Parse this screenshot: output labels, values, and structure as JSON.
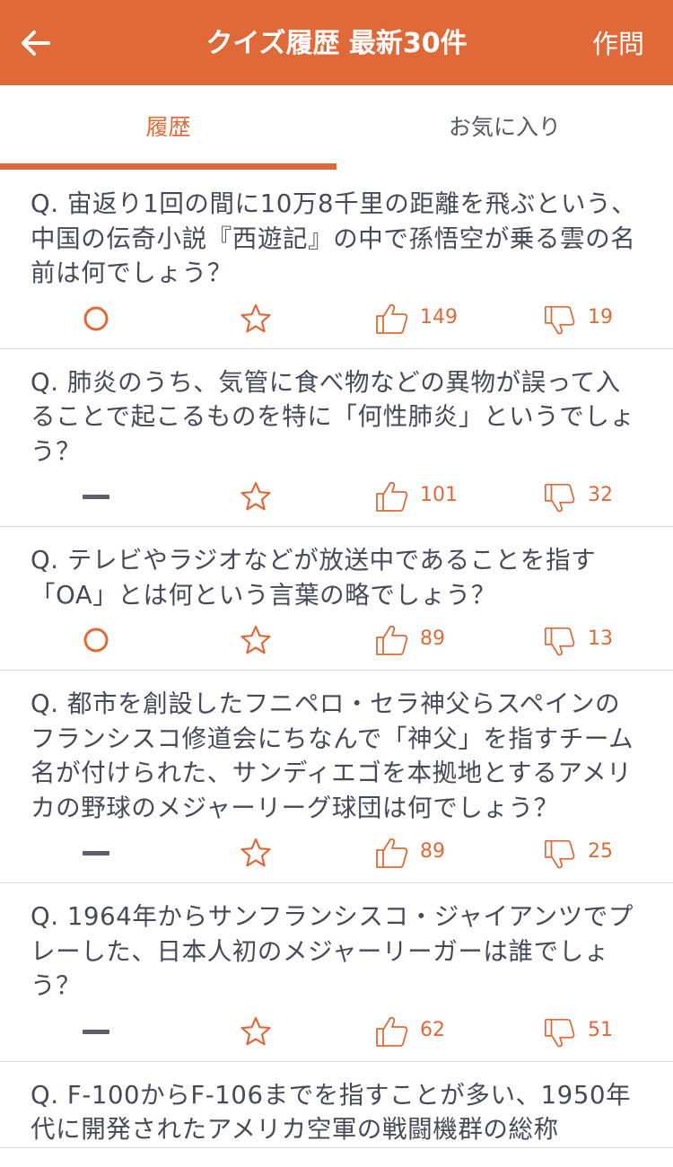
{
  "header": {
    "title": "クイズ履歴 最新30件",
    "compose_label": "作問"
  },
  "tabs": [
    {
      "label": "履歴",
      "active": true
    },
    {
      "label": "お気に入り",
      "active": false
    }
  ],
  "colors": {
    "accent": "#e0693a",
    "divider": "#d9d9d9",
    "text": "#444a58"
  },
  "items": [
    {
      "question": "Q. 宙返り1回の間に10万8千里の距離を飛ぶという、中国の伝奇小説『西遊記』の中で孫悟空が乗る雲の名前は何でしょう？",
      "result": "correct",
      "likes": "149",
      "dislikes": "19"
    },
    {
      "question": "Q. 肺炎のうち、気管に食べ物などの異物が誤って入ることで起こるものを特に「何性肺炎」というでしょう？",
      "result": "none",
      "likes": "101",
      "dislikes": "32"
    },
    {
      "question": "Q. テレビやラジオなどが放送中であることを指す「OA」とは何という言葉の略でしょう？",
      "result": "correct",
      "likes": "89",
      "dislikes": "13"
    },
    {
      "question": "Q. 都市を創設したフニペロ・セラ神父らスペインのフランシスコ修道会にちなんで「神父」を指すチーム名が付けられた、サンディエゴを本拠地とするアメリカの野球のメジャーリーグ球団は何でしょう？",
      "result": "none",
      "likes": "89",
      "dislikes": "25"
    },
    {
      "question": "Q. 1964年からサンフランシスコ・ジャイアンツでプレーした、日本人初のメジャーリーガーは誰でしょう？",
      "result": "none",
      "likes": "62",
      "dislikes": "51"
    },
    {
      "question": "Q. F-100からF-106までを指すことが多い、1950年代に開発されたアメリカ空軍の戦闘機群の総称",
      "result": "none",
      "likes": "",
      "dislikes": ""
    }
  ]
}
